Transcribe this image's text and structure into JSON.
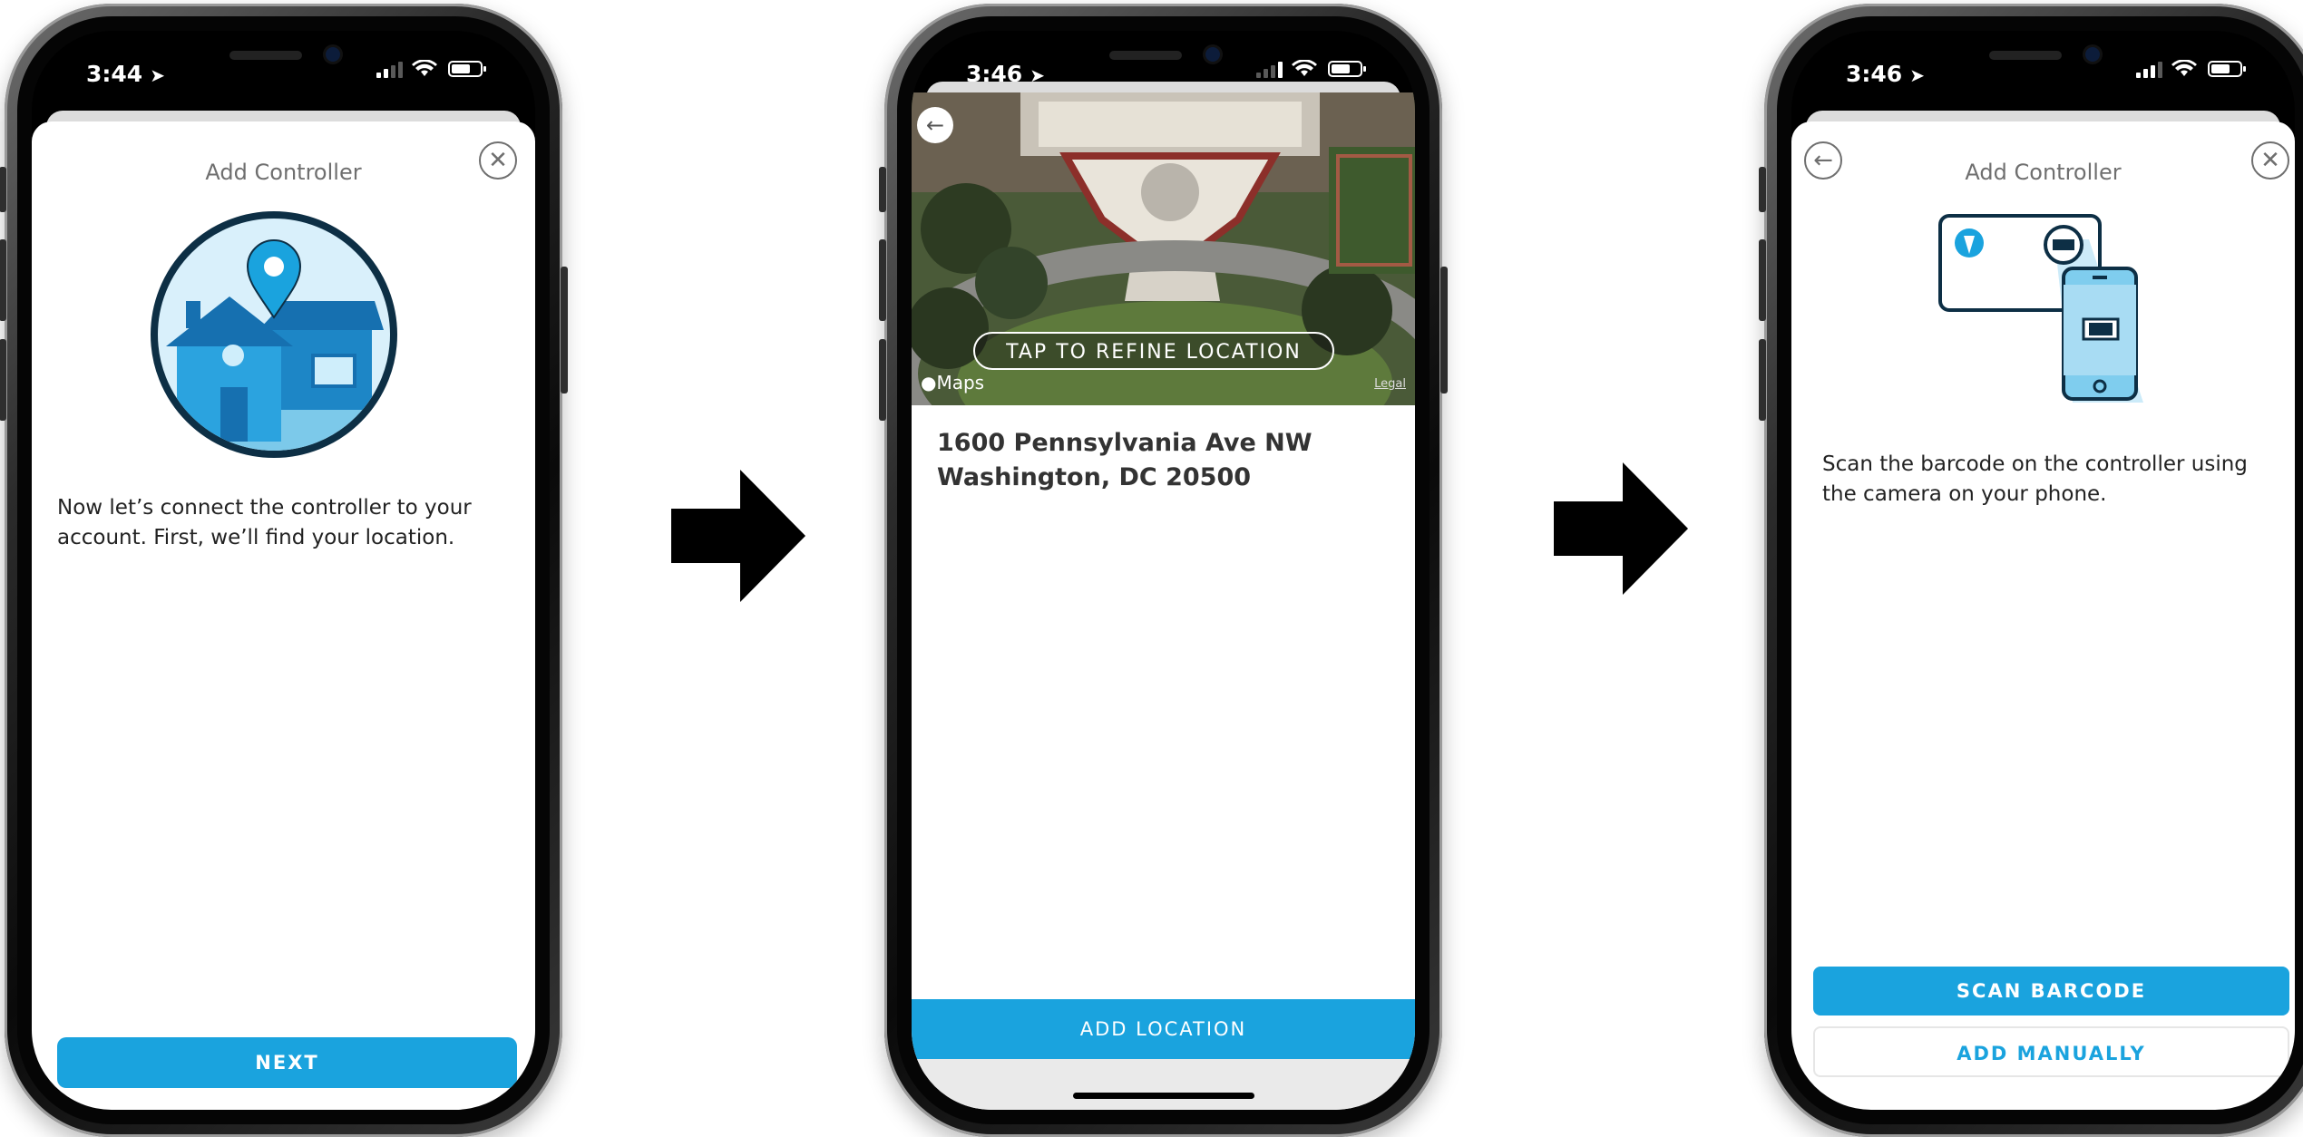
{
  "colors": {
    "accent": "#1aa3de",
    "text": "#222222",
    "muted": "#6f6f6f",
    "arrow": "#000000"
  },
  "screen1": {
    "status": {
      "time": "3:44"
    },
    "title": "Add Controller",
    "close_icon": "close-icon",
    "illustration": "house-location-pin-illustration",
    "message": "Now let’s connect the controller to your account. First, we’ll find your location.",
    "next_label": "NEXT"
  },
  "screen2": {
    "status": {
      "time": "3:46"
    },
    "map": {
      "refine_label": "TAP TO REFINE LOCATION",
      "attribution": "Maps",
      "legal": "Legal"
    },
    "address_line1": "1600 Pennsylvania Ave NW",
    "address_line2": "Washington, DC 20500",
    "add_location_label": "ADD LOCATION"
  },
  "screen3": {
    "status": {
      "time": "3:46"
    },
    "title": "Add Controller",
    "illustration": "scan-controller-barcode-illustration",
    "message": "Scan the barcode on the controller using the camera on your phone.",
    "scan_label": "SCAN BARCODE",
    "manual_label": "ADD MANUALLY"
  },
  "flow_arrows": [
    "right-arrow-icon",
    "right-arrow-icon"
  ]
}
